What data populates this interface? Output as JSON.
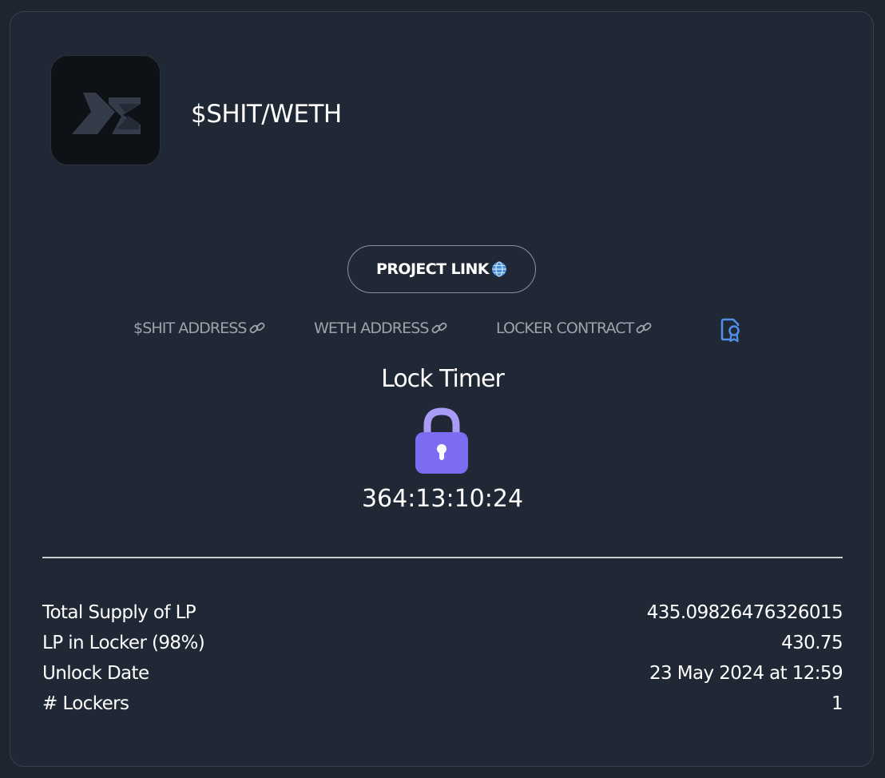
{
  "header": {
    "pair_title": "$SHIT/WETH",
    "logo_icon": "chevron-logo-icon"
  },
  "project_link": {
    "label": "PROJECT LINK",
    "icon": "globe-icon"
  },
  "links": [
    {
      "label": "$SHIT ADDRESS",
      "icon": "link-icon"
    },
    {
      "label": "WETH ADDRESS",
      "icon": "link-icon"
    },
    {
      "label": "LOCKER CONTRACT",
      "icon": "link-icon"
    }
  ],
  "certificate_icon": "certificate-icon",
  "lock": {
    "title": "Lock Timer",
    "icon": "padlock-icon",
    "timer": "364:13:10:24"
  },
  "stats": [
    {
      "label": "Total Supply of LP",
      "value": "435.09826476326015"
    },
    {
      "label": "LP in Locker (98%)",
      "value": "430.75"
    },
    {
      "label": "Unlock Date",
      "value": "23 May 2024 at 12:59"
    },
    {
      "label": "# Lockers",
      "value": "1"
    }
  ],
  "colors": {
    "background": "#202735",
    "lock_accent": "#7b6cf2",
    "certificate_accent": "#4f8fe6",
    "muted_text": "#9ea3ab"
  }
}
